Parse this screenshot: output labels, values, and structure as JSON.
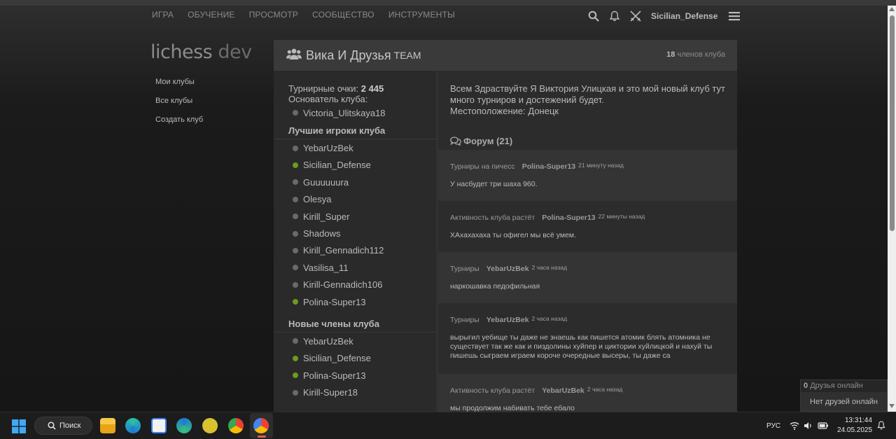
{
  "nav": {
    "items": [
      "ИГРА",
      "ОБУЧЕНИЕ",
      "ПРОСМОТР",
      "СООБЩЕСТВО",
      "ИНСТРУМЕНТЫ"
    ]
  },
  "header": {
    "username": "Sicilian_Defense"
  },
  "logo": {
    "main": "lichess",
    "suffix": "dev"
  },
  "subnav": {
    "items": [
      "Мои клубы",
      "Все клубы",
      "Создать клуб"
    ]
  },
  "club": {
    "name": "Вика И Друзья",
    "team_label": "TEAM",
    "members_count": "18",
    "members_label": "членов клуба",
    "points_label": "Турнирные очки:",
    "points_value": "2 445",
    "founder_label": "Основатель клуба:",
    "founder": "Victoria_Ulitskaya18",
    "description": "Всем Здраствуйте Я Виктория Улицкая и это мой новый клуб тут много турниров и достежений будет.",
    "location": "Местоположение: Донецк"
  },
  "best_players": {
    "title": "Лучшие игроки клуба",
    "items": [
      {
        "name": "YebarUzBek",
        "online": false
      },
      {
        "name": "Sicilian_Defense",
        "online": true
      },
      {
        "name": "Guuuuuura",
        "online": false
      },
      {
        "name": "Olesya",
        "online": false
      },
      {
        "name": "Kirill_Super",
        "online": false
      },
      {
        "name": "Shadows",
        "online": false
      },
      {
        "name": "Kirill_Gennadich112",
        "online": false
      },
      {
        "name": "Vasilisa_11",
        "online": false
      },
      {
        "name": "Kirill-Gennadich106",
        "online": false
      },
      {
        "name": "Polina-Super13",
        "online": true
      }
    ]
  },
  "new_members": {
    "title": "Новые члены клуба",
    "items": [
      {
        "name": "YebarUzBek",
        "online": false
      },
      {
        "name": "Sicilian_Defense",
        "online": true
      },
      {
        "name": "Polina-Super13",
        "online": true
      },
      {
        "name": "Kirill-Super18",
        "online": false
      }
    ]
  },
  "forum": {
    "title": "Форум (21)",
    "posts": [
      {
        "category": "Турниры на пичесс",
        "author": "Polina-Super13",
        "time": "21 минуту назад",
        "text": "У насбудет три шаха 960."
      },
      {
        "category": "Активность клуба растёт",
        "author": "Polina-Super13",
        "time": "22 минуты назад",
        "text": "ХАхахахаха ты офигел мы всё умем."
      },
      {
        "category": "Турниры",
        "author": "YebarUzBek",
        "time": "2 часа назад",
        "text": "наркошавка педофильная"
      },
      {
        "category": "Турниры",
        "author": "YebarUzBek",
        "time": "2 часа назад",
        "text": "вырыгил уебище ты даже не знаешь как пишется атомик блять атомника не существует так же как и пиздолины хуйпер и циктории хуйлицкой и нахуй ты пишешь сыграем играем короче очередные высеры, ты даже са"
      },
      {
        "category": "Активность клуба растёт",
        "author": "YebarUzBek",
        "time": "2 часа назад",
        "text": "мы продолжим набивать тебе ебало"
      }
    ]
  },
  "friends": {
    "count": "0",
    "label": "Друзья онлайн",
    "empty": "Нет друзей онлайн"
  },
  "taskbar": {
    "search": "Поиск",
    "lang": "РУС",
    "time": "13:31:44",
    "date": "24.05.2025"
  },
  "colors": {
    "online": "#6a9c1d",
    "offline": "#6a6a6a",
    "background": "#161616"
  }
}
